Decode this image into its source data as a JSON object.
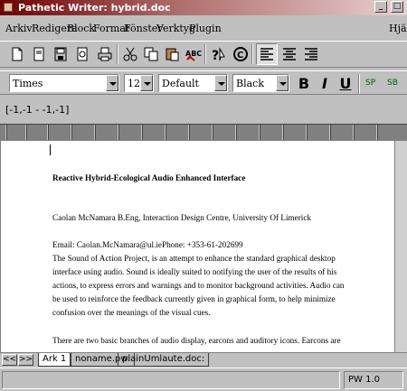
{
  "window": {
    "title": "Pathetic Writer: hybrid.doc"
  },
  "menu": {
    "items": [
      "Arkiv",
      "Redigera",
      "Block",
      "Format",
      "Fönster",
      "Verktyg",
      "Plugin"
    ],
    "help": "Hjälp"
  },
  "toolbar": {
    "icons": [
      "new-doc",
      "open-folder",
      "save-disk",
      "print-preview",
      "print",
      "cut-scissors",
      "copy",
      "paste",
      "spell-check",
      "help-pointer",
      "copyright",
      "align-left",
      "align-center",
      "align-right"
    ]
  },
  "format": {
    "font": "Times",
    "size": "12",
    "style": "Default",
    "color": "Black",
    "bold": "B",
    "italic": "I",
    "underline": "U",
    "sup": "SP",
    "sub": "SB"
  },
  "range": "[-1,-1 - -1,-1]",
  "document": {
    "lines": [
      "Reactive Hybrid-Ecological Audio Enhanced Interface",
      "Caolan McNamara B.Eng, Interaction Design Centre, University Of Limerick",
      "Email: Caolan.McNamara@ul.iePhone: +353-61-202699",
      "The Sound of Action Project, is an attempt to enhance the standard graphical desktop",
      "interface using audio. Sound is ideally suited to notifying the user of the results of his",
      "actions, to express errors and warnings and to monitor background activities. Audio can",
      "be used to reinforce the feedback currently given in graphical form, to help minimize",
      "confusion over the meanings of the visual cues.",
      "There are two basic branches of audio display, earcons and auditory icons. Earcons are"
    ]
  },
  "tabs": {
    "nav_first": "<<",
    "nav_next": ">>",
    "items": [
      "Ark 1",
      "noname.pw:",
      "plainUmlaute.doc:"
    ]
  },
  "status": {
    "mode": "PW 1.0"
  }
}
